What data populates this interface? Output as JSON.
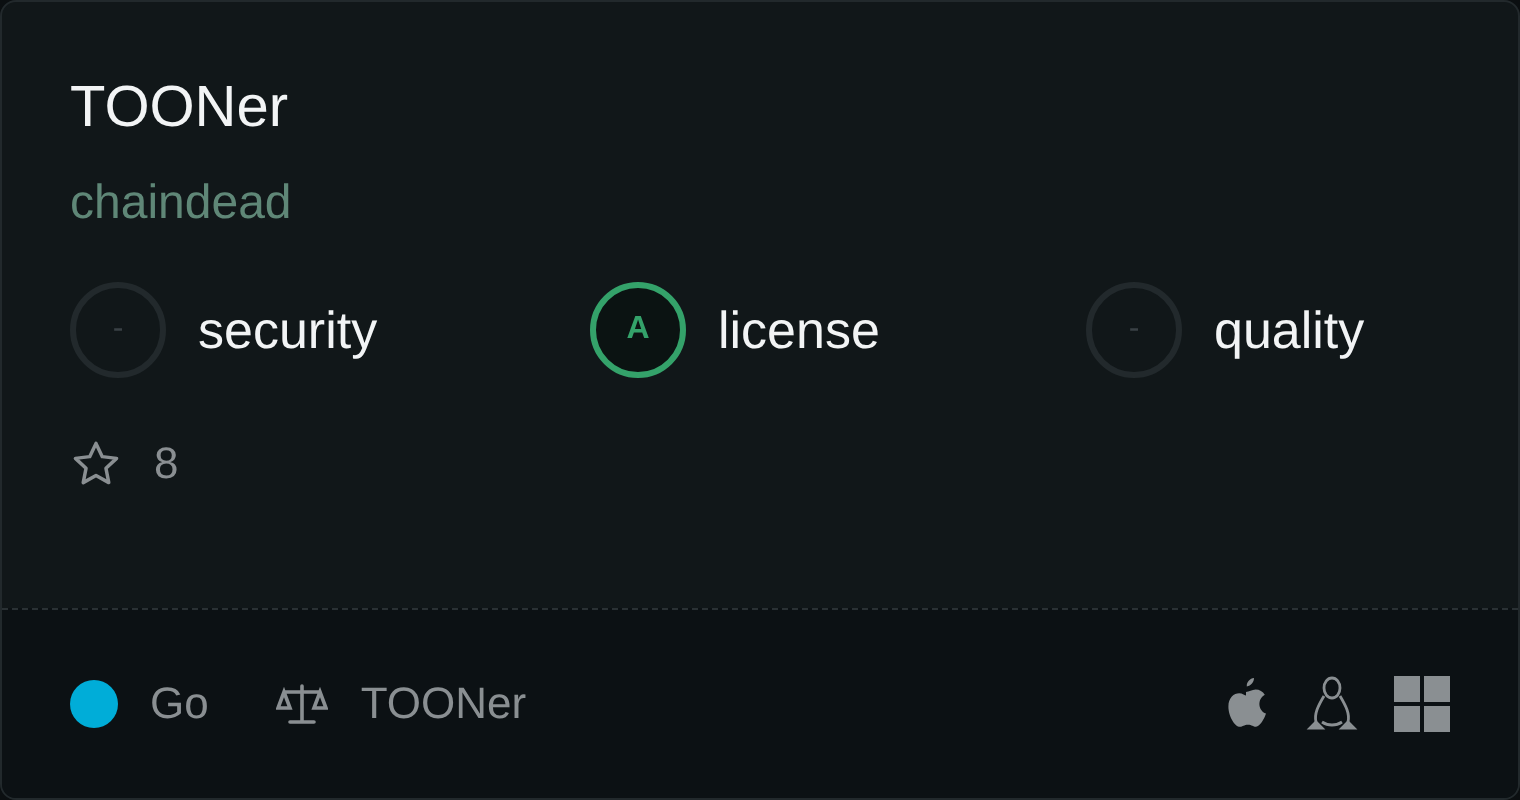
{
  "title": "TOONer",
  "owner": "chaindead",
  "scores": [
    {
      "grade": "-",
      "label": "security",
      "rated": false
    },
    {
      "grade": "A",
      "label": "license",
      "rated": true
    },
    {
      "grade": "-",
      "label": "quality",
      "rated": false
    }
  ],
  "stars": "8",
  "footer": {
    "language": {
      "name": "Go",
      "color": "#00add8"
    },
    "license": "TOONer"
  }
}
